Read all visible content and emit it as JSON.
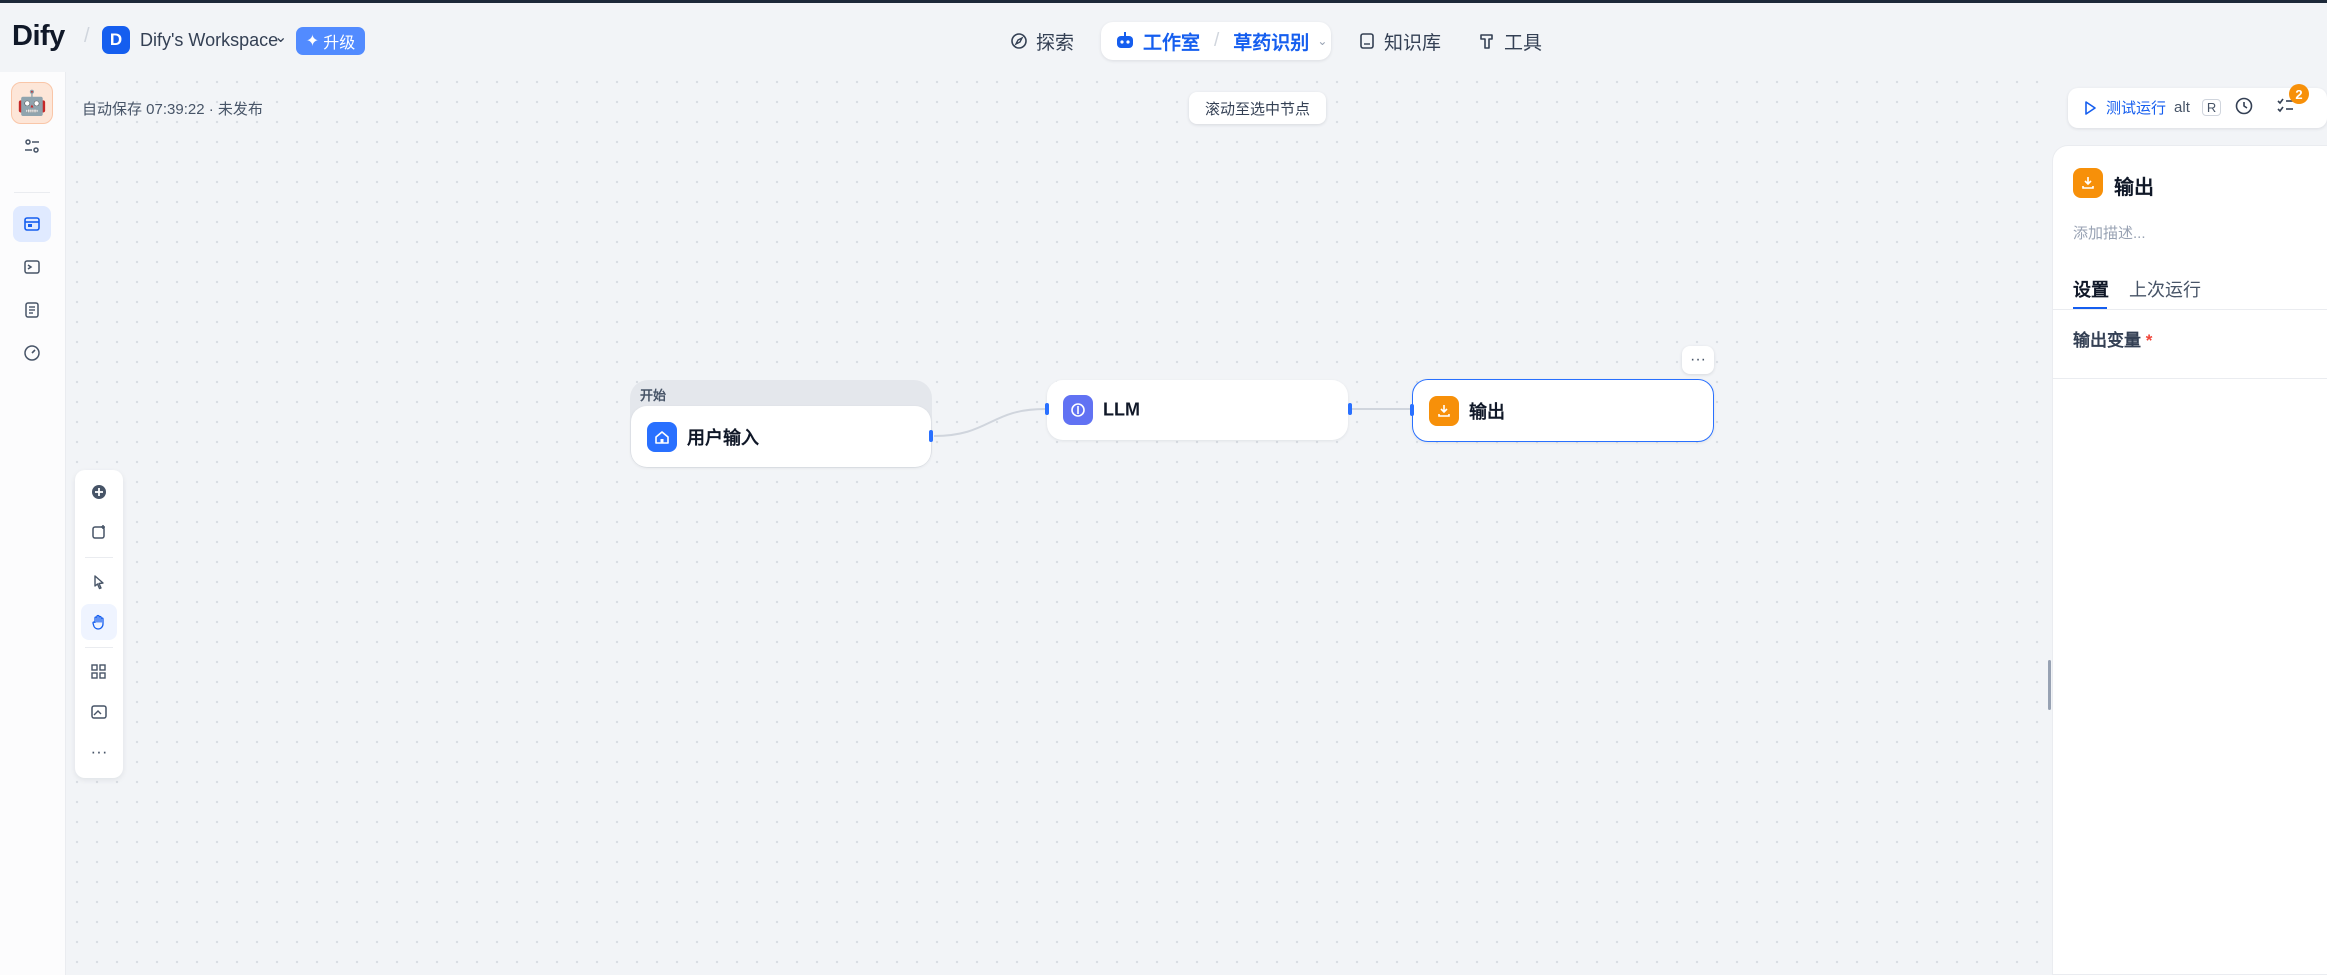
{
  "header": {
    "logo": "Dify",
    "workspace_initial": "D",
    "workspace_name": "Dify's Workspace",
    "upgrade_label": "升级",
    "nav": {
      "explore": "探索",
      "studio": "工作室",
      "current_app": "草药识别",
      "knowledge": "知识库",
      "tools": "工具"
    }
  },
  "canvas": {
    "autosave_status": "自动保存 07:39:22 · 未发布",
    "scroll_to_selected": "滚动至选中节点"
  },
  "nodes": {
    "start_group_label": "开始",
    "start_title": "用户输入",
    "llm_title": "LLM",
    "output_title": "输出"
  },
  "run_bar": {
    "test_run_label": "测试运行",
    "shortcut_mod": "alt",
    "shortcut_key": "R",
    "checklist_count": "2"
  },
  "panel": {
    "title": "输出",
    "description_placeholder": "添加描述...",
    "tabs": [
      "设置",
      "上次运行"
    ],
    "output_vars_label": "输出变量",
    "required_mark": "*"
  },
  "colors": {
    "accent": "#155eef",
    "start_icon": "#2970ff",
    "llm_icon": "#6172f3",
    "output_icon": "#f79009",
    "badge": "#f79009"
  }
}
